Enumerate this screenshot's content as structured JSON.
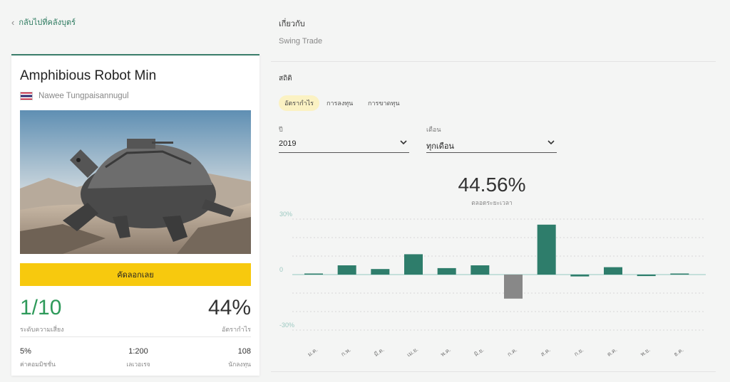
{
  "nav": {
    "back_label": "กลับไปที่คลังบุตร์"
  },
  "card": {
    "title": "Amphibious Robot Min",
    "author": "Nawee Tungpaisannugul",
    "copy_button": "คัดลอกเลย",
    "risk_value": "1/10",
    "risk_label": "ระดับความเสี่ยง",
    "gain_value": "44%",
    "gain_label": "อัตรากำไร",
    "stats": [
      {
        "value": "5%",
        "label": "ค่าคอมมิชชั่น"
      },
      {
        "value": "1:200",
        "label": "เลเวอเรจ"
      },
      {
        "value": "108",
        "label": "นักลงทุน"
      }
    ]
  },
  "about": {
    "label": "เกี่ยวกับ",
    "text": "Swing Trade"
  },
  "statistics": {
    "label": "สถิติ",
    "tabs": [
      "อัตรากำไร",
      "การลงทุน",
      "การขาดทุน"
    ],
    "year_label": "ปี",
    "year_value": "2019",
    "month_label": "เดือน",
    "month_value": "ทุกเดือน",
    "total_value": "44.56%",
    "total_label": "ตลอดระยะเวลา"
  },
  "chart_data": {
    "type": "bar",
    "categories": [
      "ม.ค.",
      "ก.พ.",
      "มี.ค.",
      "เม.ย.",
      "พ.ค.",
      "มิ.ย.",
      "ก.ค.",
      "ส.ค.",
      "ก.ย.",
      "ต.ค.",
      "พ.ย.",
      "ธ.ค."
    ],
    "values": [
      0.5,
      5,
      3,
      11,
      3.5,
      5,
      -13,
      27,
      -1,
      4,
      -0.8,
      0
    ],
    "ytick_labels": [
      "30%",
      "0",
      "-30%"
    ],
    "ylim": [
      -30,
      30
    ],
    "grid": true,
    "colors": {
      "positive": "#2e7d6b",
      "negative": "#888888",
      "zero_line": "#a9d2cc",
      "grid": "#d8d8d8"
    }
  }
}
